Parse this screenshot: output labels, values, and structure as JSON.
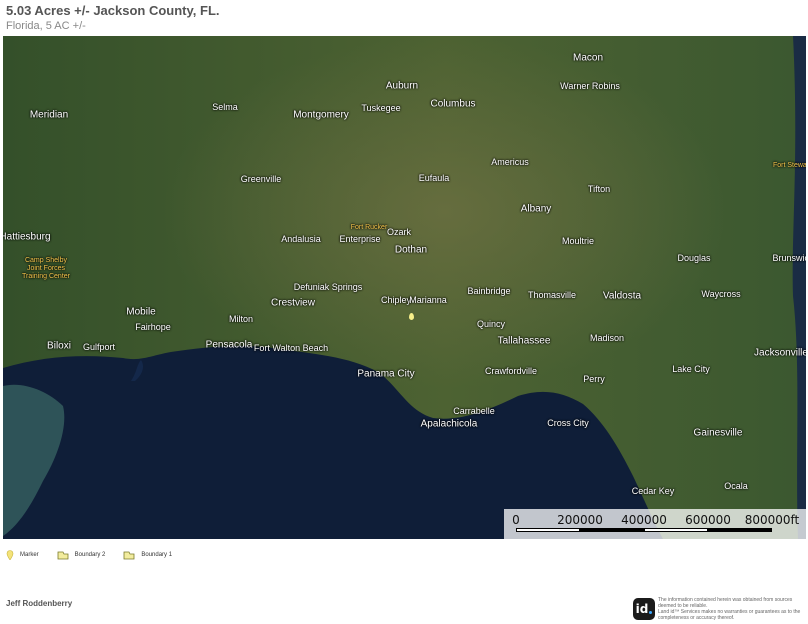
{
  "header": {
    "title": "5.03 Acres +/- Jackson County, FL.",
    "subtitle": "Florida, 5 AC +/-"
  },
  "map": {
    "imagery": "satellite",
    "colors": {
      "land": "#3f5a2a",
      "water": "#0f1e38",
      "coast": "#6f8a55"
    },
    "cities": [
      {
        "name": "Montgomery",
        "big": true
      },
      {
        "name": "Auburn",
        "big": true
      },
      {
        "name": "Columbus",
        "big": true
      },
      {
        "name": "Macon",
        "big": true
      },
      {
        "name": "Warner Robins",
        "big": false
      },
      {
        "name": "Meridian",
        "big": true
      },
      {
        "name": "Dothan",
        "big": true
      },
      {
        "name": "Albany",
        "big": true
      },
      {
        "name": "Tallahassee",
        "big": true
      },
      {
        "name": "Valdosta",
        "big": true
      },
      {
        "name": "Crestview",
        "big": true
      },
      {
        "name": "Mobile",
        "big": true
      },
      {
        "name": "Pensacola",
        "big": true
      },
      {
        "name": "Biloxi",
        "big": true
      },
      {
        "name": "Panama City",
        "big": true
      },
      {
        "name": "Apalachicola",
        "big": true
      },
      {
        "name": "Jacksonville",
        "big": true
      },
      {
        "name": "Gainesville",
        "big": true
      },
      {
        "name": "Ocala",
        "big": false
      },
      {
        "name": "Hattiesburg",
        "big": true
      },
      {
        "name": "Brunswick",
        "big": false
      },
      {
        "name": "Chipley",
        "big": false
      },
      {
        "name": "Marianna",
        "big": false
      },
      {
        "name": "Quincy",
        "big": false
      },
      {
        "name": "Thomasville",
        "big": false
      },
      {
        "name": "Madison",
        "big": false
      },
      {
        "name": "Perry",
        "big": false
      },
      {
        "name": "Fort Walton Beach",
        "big": false
      },
      {
        "name": "Gulfport",
        "big": false
      },
      {
        "name": "Crawfordville",
        "big": false
      },
      {
        "name": "Defuniak Springs",
        "big": false
      },
      {
        "name": "Andalusia",
        "big": false
      },
      {
        "name": "Enterprise",
        "big": false
      },
      {
        "name": "Ozark",
        "big": false
      },
      {
        "name": "Eufaula",
        "big": false
      },
      {
        "name": "Americus",
        "big": false
      },
      {
        "name": "Tifton",
        "big": false
      },
      {
        "name": "Moultrie",
        "big": false
      },
      {
        "name": "Greenville",
        "big": false
      },
      {
        "name": "Tuskegee",
        "big": false
      },
      {
        "name": "Selma",
        "big": false
      },
      {
        "name": "Lake City",
        "big": false
      },
      {
        "name": "Cross City",
        "big": false
      },
      {
        "name": "Cedar Key",
        "big": false
      },
      {
        "name": "Waycross",
        "big": false
      },
      {
        "name": "Douglas",
        "big": false
      },
      {
        "name": "Milton",
        "big": false
      },
      {
        "name": "Fairhope",
        "big": false
      },
      {
        "name": "Bainbridge",
        "big": false
      },
      {
        "name": "Carrabelle",
        "big": false
      }
    ],
    "bases": [
      {
        "name": "Fort Rucker"
      },
      {
        "name": "Camp Shelby Joint Forces Training Center"
      },
      {
        "name": "Fort Stewart"
      }
    ],
    "scale": {
      "ticks": [
        "0",
        "200000",
        "400000",
        "600000",
        "800000ft"
      ]
    }
  },
  "legend": [
    {
      "label": "Marker",
      "icon": "marker-icon"
    },
    {
      "label": "Boundary 2",
      "icon": "boundary-icon"
    },
    {
      "label": "Boundary 1",
      "icon": "boundary-icon"
    }
  ],
  "footer": {
    "agent_name": "Jeff Roddenberry",
    "logo_text": "id",
    "disclaimer": [
      "The information contained herein was obtained from sources",
      "deemed to be reliable.",
      "Land id™ Services makes no warranties or guarantees as to the",
      "completeness or accuracy thereof."
    ]
  }
}
